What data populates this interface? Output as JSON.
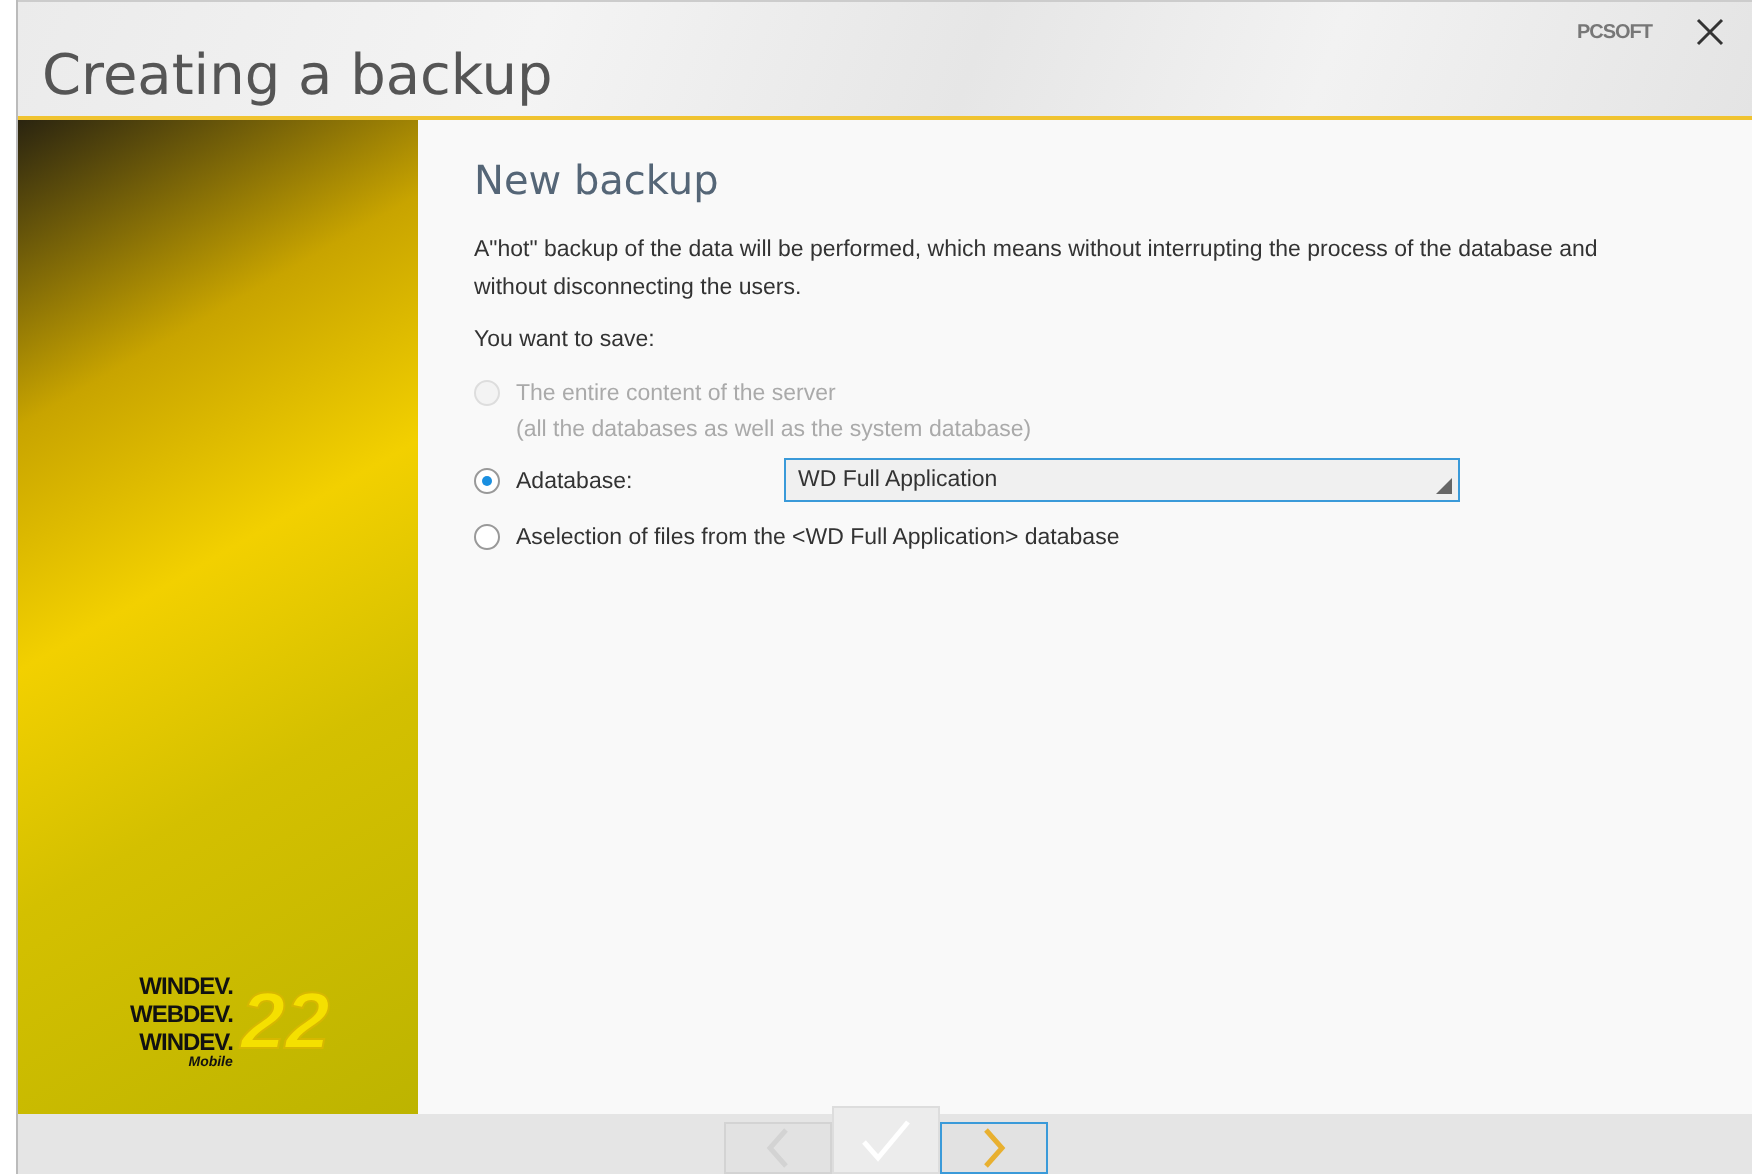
{
  "window": {
    "title": "Creating a backup",
    "brand": "PCSOFT"
  },
  "page": {
    "heading": "New backup",
    "description": "A\"hot\" backup of the data will be performed, which means without interrupting the process of the database and without disconnecting the users.",
    "prompt": "You want to save:"
  },
  "options": [
    {
      "label": "The entire content of the server",
      "note": "(all the databases as well as the system database)",
      "selected": false,
      "disabled": true
    },
    {
      "label": "Adatabase:",
      "selected": true,
      "disabled": false,
      "dropdown": {
        "value": "WD Full Application"
      }
    },
    {
      "label": "Aselection of files from the <WD Full Application> database",
      "selected": false,
      "disabled": false
    }
  ],
  "logo": {
    "lines": [
      "WINDEV.",
      "WEBDEV.",
      "WINDEV."
    ],
    "sub": "Mobile",
    "version": "22"
  },
  "nav": [
    {
      "kind": "back",
      "disabled": true
    },
    {
      "kind": "finish",
      "disabled": false
    },
    {
      "kind": "next",
      "disabled": false
    }
  ]
}
